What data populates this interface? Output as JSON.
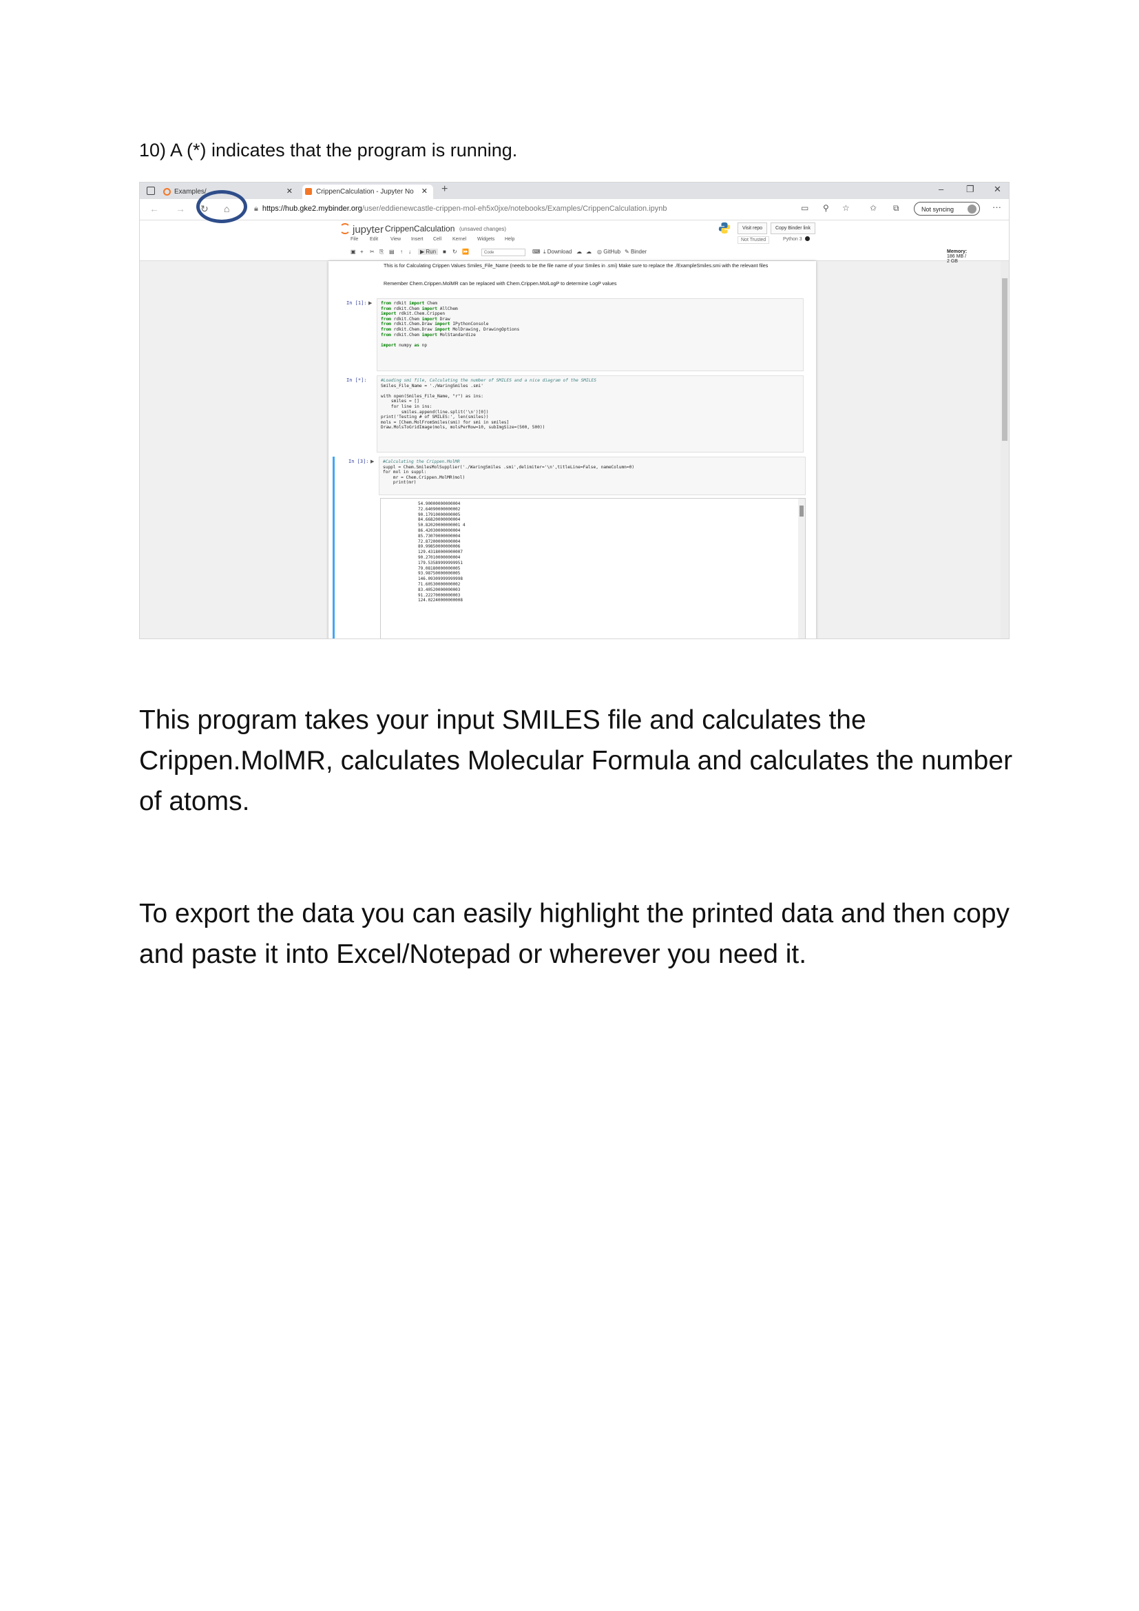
{
  "step_text": "10) A (*) indicates that the program is running.",
  "browser": {
    "tabs": [
      {
        "label": "Examples/",
        "active": false
      },
      {
        "label": "CrippenCalculation - Jupyter No",
        "active": true
      }
    ],
    "url_host": "https://hub.gke2.mybinder.org",
    "url_path": "/user/eddienewcastle-crippen-mol-eh5x0jxe/notebooks/Examples/CrippenCalculation.ipynb",
    "sync_label": "Not syncing"
  },
  "jupyter": {
    "logo": "jupyter",
    "notebook_name": "CrippenCalculation",
    "unsaved": "(unsaved changes)",
    "visit_repo": "Visit repo",
    "copy_binder": "Copy Binder link",
    "menu": [
      "File",
      "Edit",
      "View",
      "Insert",
      "Cell",
      "Kernel",
      "Widgets",
      "Help"
    ],
    "trust": "Not Trusted",
    "kernel": "Python 3",
    "cell_type": "Code",
    "run_label": "Run",
    "download": "Download",
    "github": "GitHub",
    "binder": "Binder",
    "memory_label": "Memory:",
    "memory_value": "186 MB / 2 GB"
  },
  "notebook": {
    "md1": "This is for Calculating Crippen Values Smiles_File_Name (needs to be the file name of your Smiles in .smi) Make sure to replace the ./ExampleSmiles.smi with the relevant files",
    "md2": "Remember Chem.Crippen.MolMR can be replaced with Chem.Crippen.MolLogP to determine LogP values",
    "cells": [
      {
        "prompt": "In [1]:",
        "lines": [
          "from rdkit import Chem",
          "from rdkit.Chem import AllChem",
          "import rdkit.Chem.Crippen",
          "from rdkit.Chem import Draw",
          "from rdkit.Chem.Draw import IPythonConsole",
          "from rdkit.Chem.Draw import MolDrawing, DrawingOptions",
          "from rdkit.Chem import MolStandardize",
          "",
          "import numpy as np"
        ]
      },
      {
        "prompt": "In [*]:",
        "lines": [
          "#Loading smi file, Calculating the number of SMILES and a nice diagram of the SMILES",
          "Smiles_File_Name = './WaringSmiles .smi'",
          "",
          "with open(Smiles_File_Name, \"r\") as ins:",
          "    smiles = []",
          "    for line in ins:",
          "        smiles.append(line.split('\\n')[0])",
          "print('Testing # of SMILES:', len(smiles))",
          "mols = [Chem.MolFromSmiles(smi) for smi in smiles]",
          "Draw.MolsToGridImage(mols, molsPerRow=10, subImgSize=(500, 500))"
        ]
      },
      {
        "prompt": "In [3]:",
        "lines": [
          "#Calculating the Crippen.MolMR",
          "suppl = Chem.SmilesMolSupplier('./WaringSmiles .smi',delimiter='\\n',titleLine=False, nameColumn=0)",
          "for mol in suppl:",
          "    mr = Chem.Crippen.MolMR(mol)",
          "    print(mr)"
        ]
      }
    ],
    "output": [
      "54.90000000000004",
      "72.64090000000002",
      "90.17910000000005",
      "84.66820000000004",
      "50.82020000000001 4",
      "86.42030000000004",
      "85.73070000000004",
      "72.87200000000004",
      "89.99850000000006",
      "129.43180000000007",
      "90.27010000000004",
      "179.53589999999951",
      "79.08180000000005",
      "93.98750000000005",
      "146.09309999999998",
      "71.60530000000002",
      "83.40520000000003",
      "91.22270000000003",
      "124.02240000000008"
    ]
  },
  "paragraphs": [
    "This program takes your input SMILES file and calculates the Crippen.MolMR, calculates Molecular Formula and calculates the number of atoms.",
    "To export the data you can easily highlight the printed data and then copy and paste it into Excel/Notepad or wherever you need it."
  ]
}
